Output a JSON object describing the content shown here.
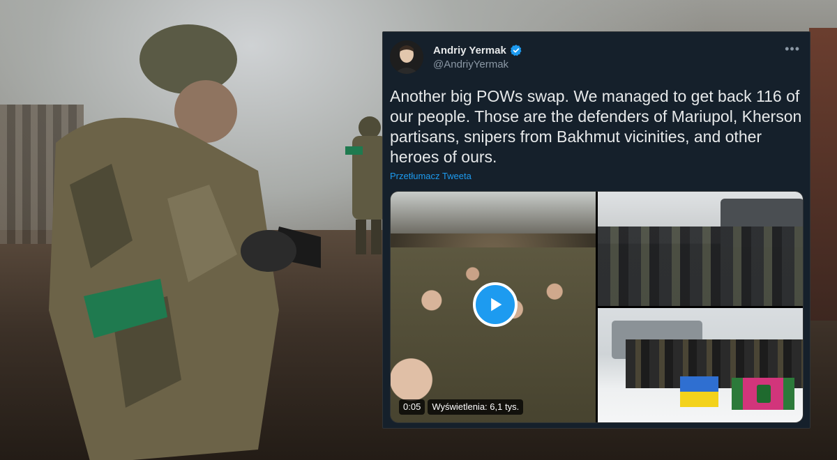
{
  "tweet": {
    "author_name": "Andriy Yermak",
    "handle": "@AndriyYermak",
    "verified": true,
    "text": "Another big POWs swap. We managed to get back 116 of our people. Those are the defenders of Mariupol, Kherson partisans, snipers from Bakhmut vicinities, and other heroes of ours.",
    "translate_label": "Przetłumacz Tweeta",
    "more_icon": "more-horizontal-icon"
  },
  "video": {
    "duration": "0:05",
    "views_label": "Wyświetlenia: 6,1 tys."
  },
  "colors": {
    "card_bg": "#15202b",
    "accent": "#1d9bf0",
    "text": "#e7e9ea",
    "muted": "#8b98a5"
  }
}
